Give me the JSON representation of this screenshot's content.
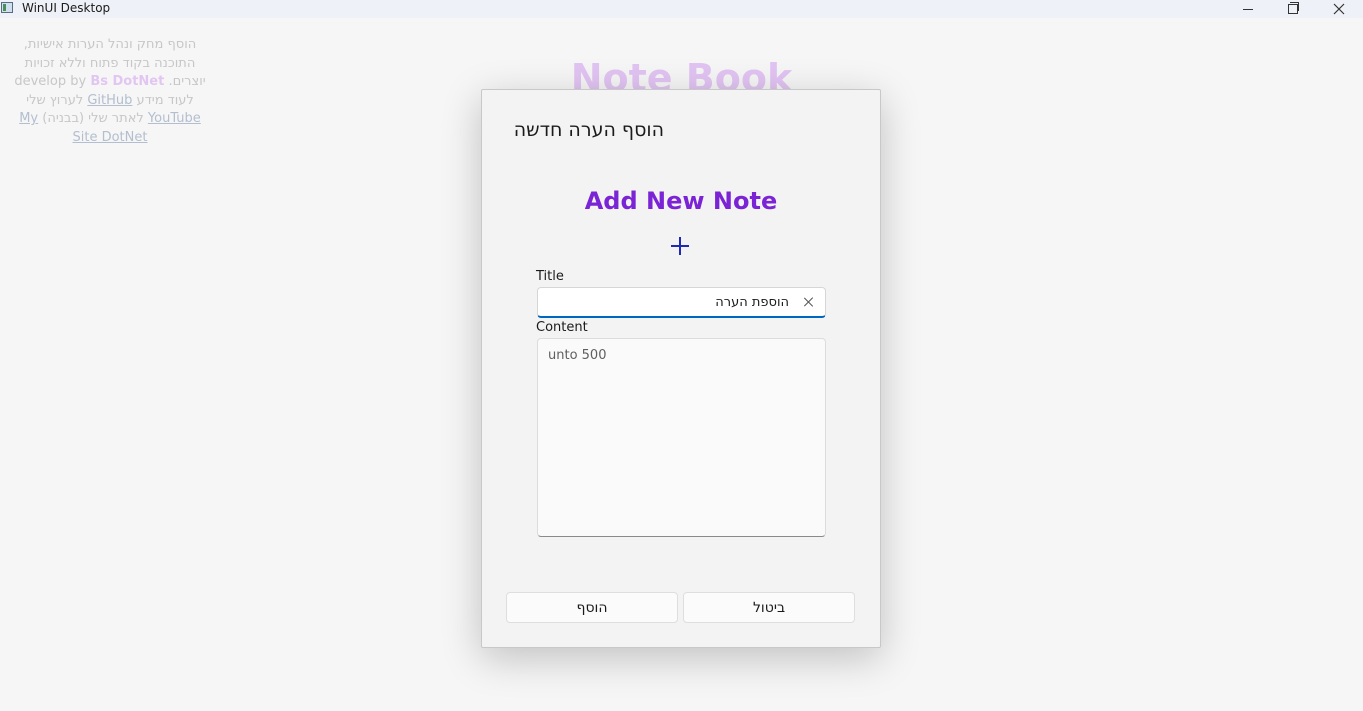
{
  "window": {
    "title": "WinUI Desktop",
    "icon": "app-window-icon",
    "controls": [
      "minimize-icon",
      "maximize-icon",
      "close-icon"
    ]
  },
  "info": {
    "line1": "הוסף מחק ונהל הערות אישיות,",
    "line2": "התוכנה בקוד פתוח וללא זכויות",
    "line3_pre": "יוצרים. ",
    "line3_en": "develop by ",
    "brand": "Bs DotNet",
    "line4_text": "לעוד מידע ",
    "github": "GitHub",
    "line4_tail": " לערוץ שלי",
    "youtube": "YouTube",
    "line5_text": " לאתר שלי (בבניה) ",
    "site": "My Site DotNet"
  },
  "page": {
    "title": "Note Book"
  },
  "dialog": {
    "title": "הוסף הערה חדשה",
    "heading": "Add New Note",
    "add_icon": "plus-icon",
    "title_label": "Title",
    "title_value": "הוספת הערה",
    "content_label": "Content",
    "content_placeholder": "unto 500",
    "primary_button": "הוסף",
    "secondary_button": "ביטול"
  },
  "colors": {
    "accent": "#0067c0",
    "heading_purple": "#7a24d6",
    "brand_purple": "#d9b3ee",
    "plus_blue": "#1d2bb0"
  }
}
